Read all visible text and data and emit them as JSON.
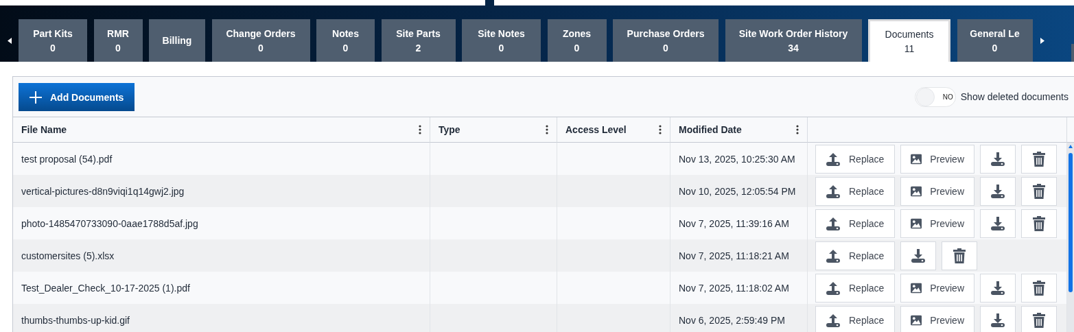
{
  "tabs": [
    {
      "label": "Part Kits",
      "count": "0",
      "selected": false
    },
    {
      "label": "RMR",
      "count": "0",
      "selected": false
    },
    {
      "label": "Billing",
      "selected": false
    },
    {
      "label": "Change Orders",
      "count": "0",
      "selected": false
    },
    {
      "label": "Notes",
      "count": "0",
      "selected": false
    },
    {
      "label": "Site Parts",
      "count": "2",
      "selected": false
    },
    {
      "label": "Site Notes",
      "count": "0",
      "selected": false
    },
    {
      "label": "Zones",
      "count": "0",
      "selected": false
    },
    {
      "label": "Purchase Orders",
      "count": "0",
      "selected": false
    },
    {
      "label": "Site Work Order History",
      "count": "34",
      "selected": false
    },
    {
      "label": "Documents",
      "count": "11",
      "selected": true
    },
    {
      "label": "General Le",
      "count": "0",
      "selected": false
    }
  ],
  "toolbar": {
    "add_button": "Add Documents",
    "show_deleted": {
      "label": "Show deleted documents",
      "on": false,
      "state_text": "NO"
    }
  },
  "table": {
    "columns": [
      "File Name",
      "Type",
      "Access Level",
      "Modified Date"
    ],
    "rows": [
      {
        "file_name": "test proposal (54).pdf",
        "modified": "Nov 13, 2025, 10:25:30 AM",
        "actions": [
          {
            "kind": "replace",
            "label": "Replace"
          },
          {
            "kind": "preview",
            "label": "Preview"
          },
          {
            "kind": "download"
          },
          {
            "kind": "delete"
          }
        ]
      },
      {
        "file_name": "vertical-pictures-d8n9viqi1q14gwj2.jpg",
        "modified": "Nov 10, 2025, 12:05:54 PM",
        "actions": [
          {
            "kind": "replace",
            "label": "Replace"
          },
          {
            "kind": "preview",
            "label": "Preview"
          },
          {
            "kind": "download"
          },
          {
            "kind": "delete"
          }
        ]
      },
      {
        "file_name": "photo-1485470733090-0aae1788d5af.jpg",
        "modified": "Nov 7, 2025, 11:39:16 AM",
        "actions": [
          {
            "kind": "replace",
            "label": "Replace"
          },
          {
            "kind": "preview",
            "label": "Preview"
          },
          {
            "kind": "download"
          },
          {
            "kind": "delete"
          }
        ]
      },
      {
        "file_name": "customersites (5).xlsx",
        "modified": "Nov 7, 2025, 11:18:21 AM",
        "actions": [
          {
            "kind": "replace",
            "label": "Replace"
          },
          {
            "kind": "download"
          },
          {
            "kind": "delete"
          }
        ]
      },
      {
        "file_name": "Test_Dealer_Check_10-17-2025 (1).pdf",
        "modified": "Nov 7, 2025, 11:18:02 AM",
        "actions": [
          {
            "kind": "replace",
            "label": "Replace"
          },
          {
            "kind": "preview",
            "label": "Preview"
          },
          {
            "kind": "download"
          },
          {
            "kind": "delete"
          }
        ]
      },
      {
        "file_name": "thumbs-thumbs-up-kid.gif",
        "modified": "Nov 6, 2025, 2:59:49 PM",
        "actions": [
          {
            "kind": "replace",
            "label": "Replace"
          },
          {
            "kind": "preview",
            "label": "Preview"
          },
          {
            "kind": "download"
          },
          {
            "kind": "delete"
          }
        ]
      }
    ]
  }
}
